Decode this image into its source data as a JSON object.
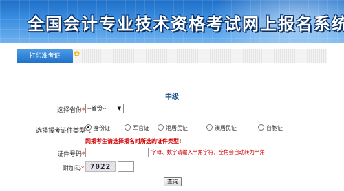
{
  "header": {
    "title": "全国会计专业技术资格考试网上报名系统"
  },
  "tabs": {
    "active_label": "打印准考证"
  },
  "form": {
    "heading": "中级",
    "province_label": "选择省份",
    "province_value": "--省份--",
    "id_type_label": "选择报考证件类型",
    "id_types": [
      "身份证",
      "军官证",
      "港居民证",
      "澳居民证",
      "台胞证"
    ],
    "id_type_selected": "身份证",
    "warning": "网报考生请选择报名时所选的证件类型!",
    "id_number_label": "证件号码",
    "id_number_value": "",
    "id_hint": "字母、数字请输入半角字符，全角会自动转为半角",
    "captcha_label": "附加码",
    "captcha_text": "7022",
    "captcha_value": "",
    "required_mark": "*",
    "submit_label": "查询"
  }
}
